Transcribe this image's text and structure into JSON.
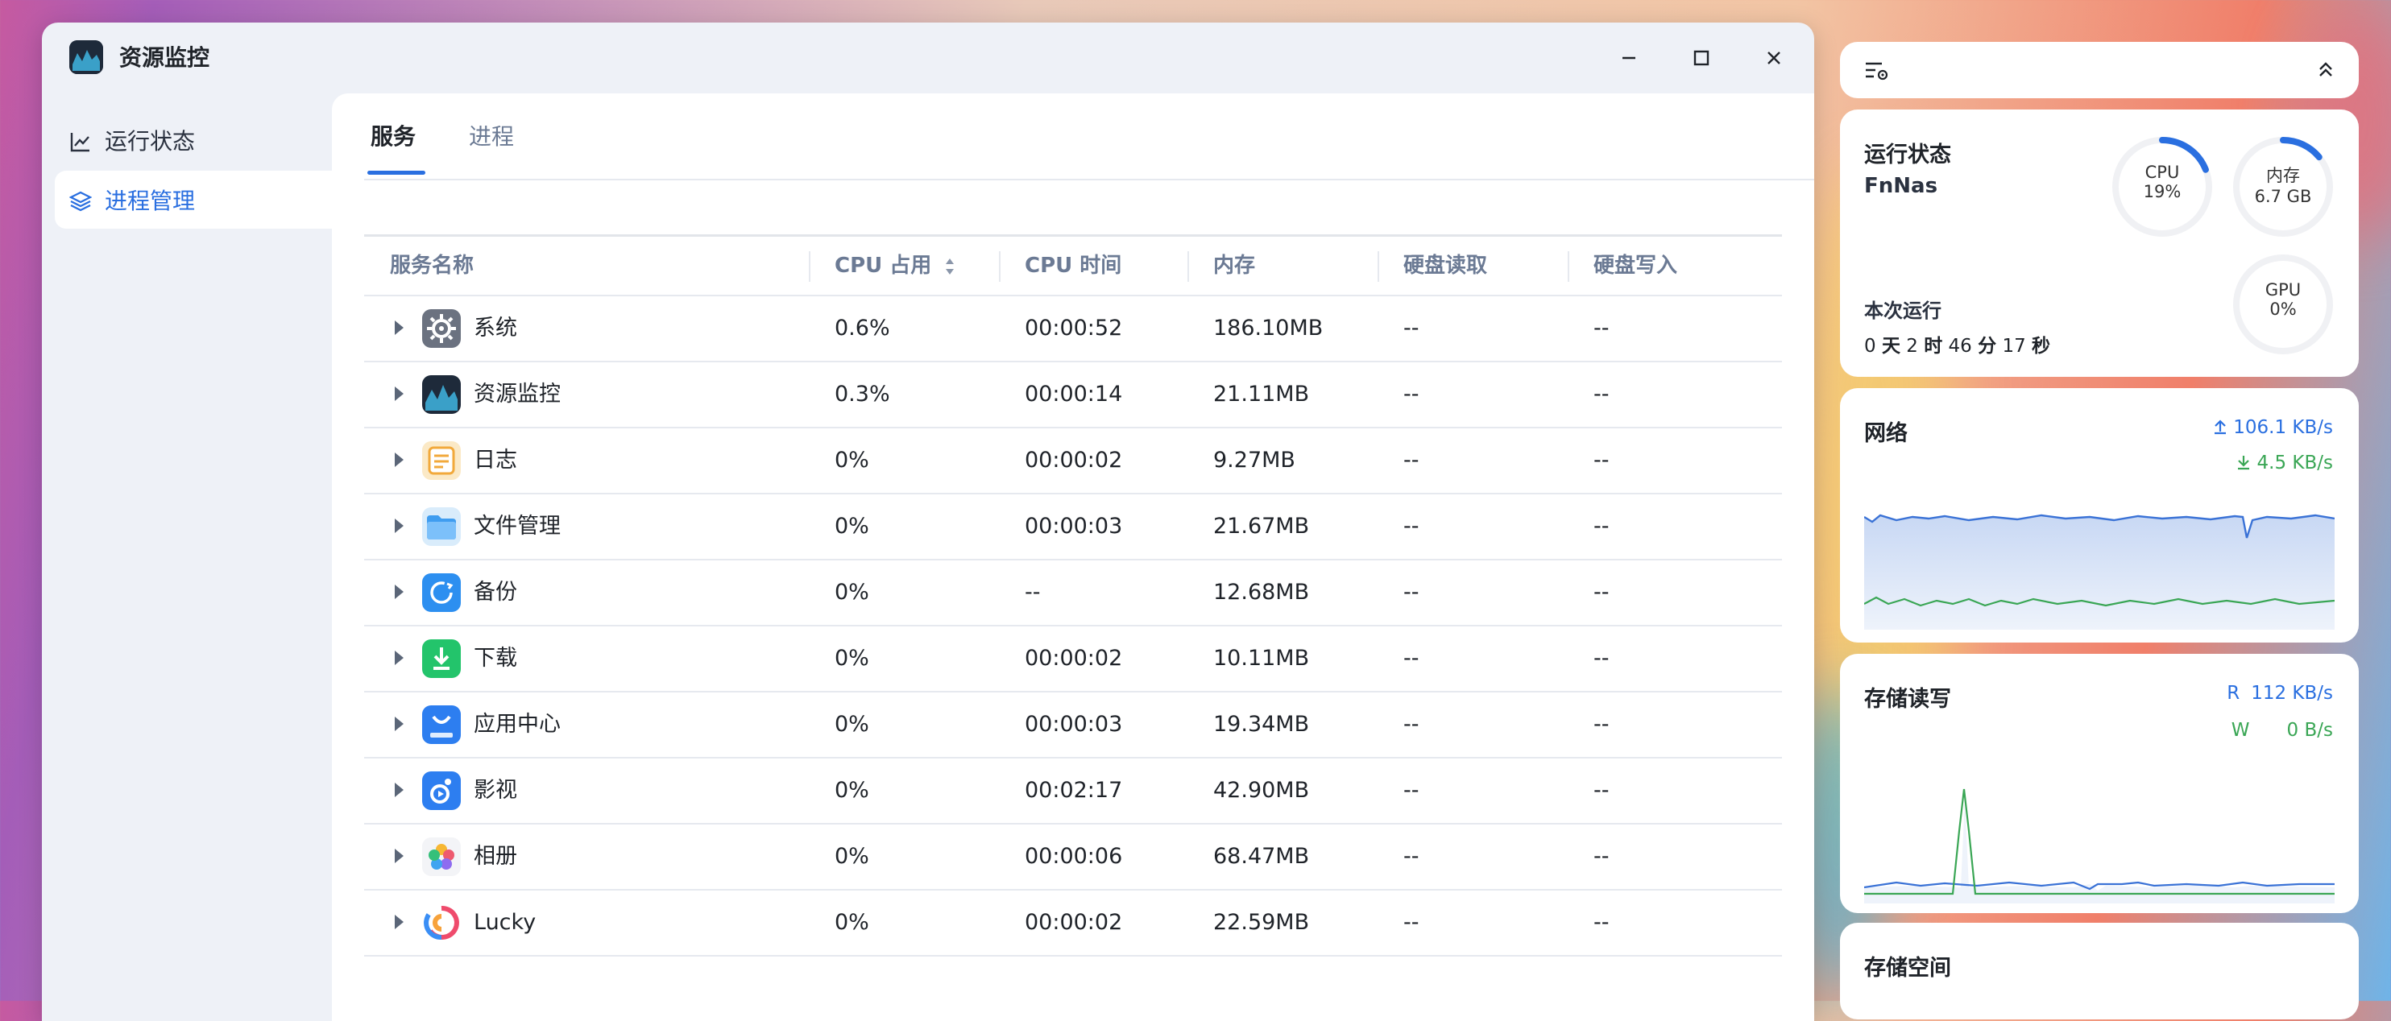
{
  "window": {
    "title": "资源监控"
  },
  "sidebar": {
    "items": [
      {
        "label": "运行状态",
        "icon": "line-chart-icon",
        "active": false
      },
      {
        "label": "进程管理",
        "icon": "layers-icon",
        "active": true
      }
    ]
  },
  "tabs": [
    {
      "label": "服务",
      "active": true
    },
    {
      "label": "进程",
      "active": false
    }
  ],
  "table": {
    "headers": [
      "服务名称",
      "CPU 占用",
      "CPU 时间",
      "内存",
      "硬盘读取",
      "硬盘写入"
    ],
    "rows": [
      {
        "name": "系统",
        "cpu": "0.6%",
        "time": "00:00:52",
        "mem": "186.10MB",
        "read": "--",
        "write": "--"
      },
      {
        "name": "资源监控",
        "cpu": "0.3%",
        "time": "00:00:14",
        "mem": "21.11MB",
        "read": "--",
        "write": "--"
      },
      {
        "name": "日志",
        "cpu": "0%",
        "time": "00:00:02",
        "mem": "9.27MB",
        "read": "--",
        "write": "--"
      },
      {
        "name": "文件管理",
        "cpu": "0%",
        "time": "00:00:03",
        "mem": "21.67MB",
        "read": "--",
        "write": "--"
      },
      {
        "name": "备份",
        "cpu": "0%",
        "time": "--",
        "mem": "12.68MB",
        "read": "--",
        "write": "--"
      },
      {
        "name": "下载",
        "cpu": "0%",
        "time": "00:00:02",
        "mem": "10.11MB",
        "read": "--",
        "write": "--"
      },
      {
        "name": "应用中心",
        "cpu": "0%",
        "time": "00:00:03",
        "mem": "19.34MB",
        "read": "--",
        "write": "--"
      },
      {
        "name": "影视",
        "cpu": "0%",
        "time": "00:02:17",
        "mem": "42.90MB",
        "read": "--",
        "write": "--"
      },
      {
        "name": "相册",
        "cpu": "0%",
        "time": "00:00:06",
        "mem": "68.47MB",
        "read": "--",
        "write": "--"
      },
      {
        "name": "Lucky",
        "cpu": "0%",
        "time": "00:00:02",
        "mem": "22.59MB",
        "read": "--",
        "write": "--"
      }
    ]
  },
  "status": {
    "title": "运行状态",
    "host": "FnNas",
    "uptime_label": "本次运行",
    "uptime": {
      "d": "0",
      "d_unit": "天",
      "h": "2",
      "h_unit": "时",
      "m": "46",
      "m_unit": "分",
      "s": "17",
      "s_unit": "秒"
    },
    "cpu": {
      "label": "CPU",
      "value": "19%",
      "fraction": 0.19
    },
    "mem": {
      "label": "内存",
      "value": "6.7 GB",
      "fraction": 0.14
    },
    "gpu": {
      "label": "GPU",
      "value": "0%",
      "fraction": 0
    }
  },
  "network": {
    "title": "网络",
    "up": "106.1 KB/s",
    "down": "4.5 KB/s"
  },
  "storage_io": {
    "title": "存储读写",
    "read_label": "R",
    "read": "112 KB/s",
    "write_label": "W",
    "write": "0 B/s"
  },
  "storage_space": {
    "title": "存储空间"
  },
  "colors": {
    "accent": "#2a6fe0",
    "upload": "#2a6fe0",
    "download": "#3aa655"
  }
}
